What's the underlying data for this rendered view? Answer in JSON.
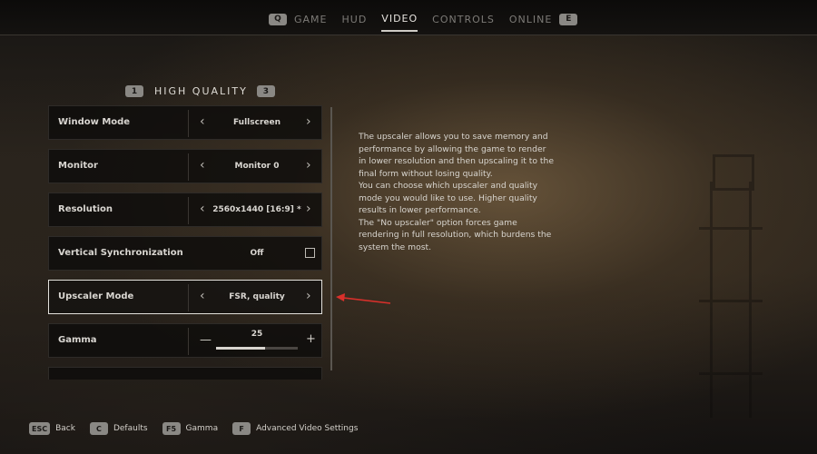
{
  "topnav": {
    "left_key": "Q",
    "right_key": "E",
    "tabs": [
      {
        "label": "GAME"
      },
      {
        "label": "HUD"
      },
      {
        "label": "VIDEO"
      },
      {
        "label": "CONTROLS"
      },
      {
        "label": "ONLINE"
      }
    ],
    "active_tab": "VIDEO"
  },
  "preset": {
    "prev_key": "1",
    "label": "HIGH QUALITY",
    "next_key": "3"
  },
  "settings": [
    {
      "name": "Window Mode",
      "value": "Fullscreen"
    },
    {
      "name": "Monitor",
      "value": "Monitor 0"
    },
    {
      "name": "Resolution",
      "value": "2560x1440 [16:9] *"
    },
    {
      "name": "Vertical Synchronization",
      "value": "Off",
      "checked": false
    },
    {
      "name": "Upscaler Mode",
      "value": "FSR, quality",
      "selected": true
    },
    {
      "name": "Gamma",
      "value": "25",
      "slider_fraction": 0.6
    }
  ],
  "description": [
    "The upscaler allows you to save memory and performance by allowing the game to render in lower resolution and then upscaling it to the final form without losing quality.",
    "You can choose which upscaler and quality mode you would like to use. Higher quality results in lower performance.",
    "The \"No upscaler\" option forces game rendering in full resolution, which burdens the system the most."
  ],
  "annotation_color": "#d9302b",
  "hints": [
    {
      "key": "ESC",
      "label": "Back"
    },
    {
      "key": "C",
      "label": "Defaults"
    },
    {
      "key": "F5",
      "label": "Gamma"
    },
    {
      "key": "F",
      "label": "Advanced Video Settings"
    }
  ]
}
